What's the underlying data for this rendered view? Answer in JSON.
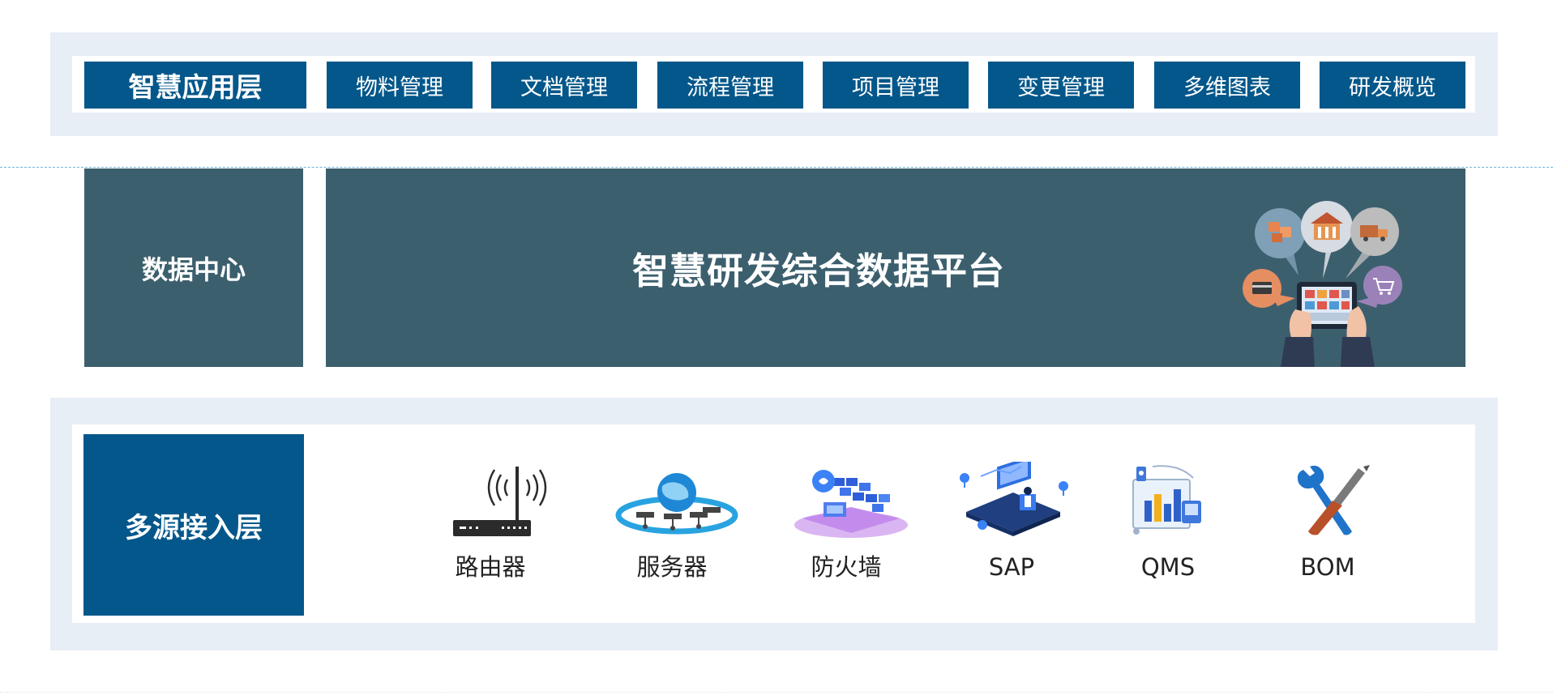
{
  "application_layer": {
    "title": "智慧应用层",
    "modules": [
      "物料管理",
      "文档管理",
      "流程管理",
      "项目管理",
      "变更管理",
      "多维图表",
      "研发概览"
    ]
  },
  "data_center": {
    "label": "数据中心",
    "platform_title": "智慧研发综合数据平台"
  },
  "source_layer": {
    "title": "多源接入层",
    "sources": [
      {
        "label": "路由器",
        "icon": "router-icon"
      },
      {
        "label": "服务器",
        "icon": "server-cloud-icon"
      },
      {
        "label": "防火墙",
        "icon": "firewall-icon"
      },
      {
        "label": "SAP",
        "icon": "sap-isometric-icon"
      },
      {
        "label": "QMS",
        "icon": "qms-dashboard-icon"
      },
      {
        "label": "BOM",
        "icon": "wrench-screwdriver-icon"
      }
    ]
  },
  "colors": {
    "primary": "#04578a",
    "data_panel": "#3c5f6e",
    "band": "#e8eef6"
  }
}
